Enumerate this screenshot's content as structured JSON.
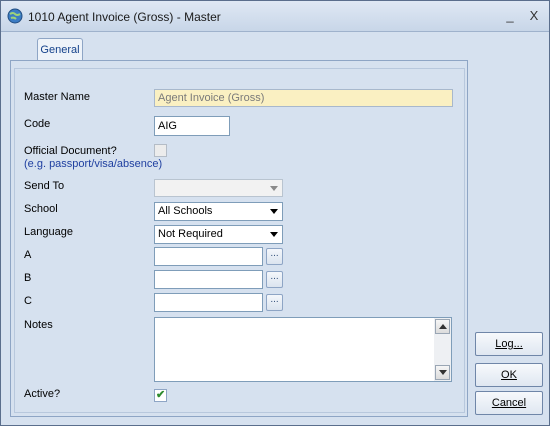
{
  "window": {
    "title": "1010 Agent Invoice (Gross) - Master",
    "icon": "app-globe-icon",
    "minimize_glyph": "_",
    "close_glyph": "X"
  },
  "tabs": [
    {
      "label": "General"
    }
  ],
  "form": {
    "master_name": {
      "label": "Master Name",
      "value": "Agent Invoice (Gross)"
    },
    "code": {
      "label": "Code",
      "value": "AIG"
    },
    "official_document": {
      "label": "Official Document?",
      "hint": "(e.g. passport/visa/absence)",
      "checked": false
    },
    "send_to": {
      "label": "Send To",
      "value": ""
    },
    "school": {
      "label": "School",
      "value": "All Schools"
    },
    "language": {
      "label": "Language",
      "value": "Not Required"
    },
    "a": {
      "label": "A",
      "value": "",
      "button": "..."
    },
    "b": {
      "label": "B",
      "value": "",
      "button": "..."
    },
    "c": {
      "label": "C",
      "value": "",
      "button": "..."
    },
    "notes": {
      "label": "Notes",
      "value": ""
    },
    "active": {
      "label": "Active?",
      "checked": true,
      "check_glyph": "✔"
    }
  },
  "buttons": {
    "log": "Log...",
    "ok": "OK",
    "cancel": "Cancel"
  },
  "colors": {
    "readonly_field": "#faf0c2",
    "tab_text": "#15428b",
    "hint_text": "#1f3fa0"
  }
}
